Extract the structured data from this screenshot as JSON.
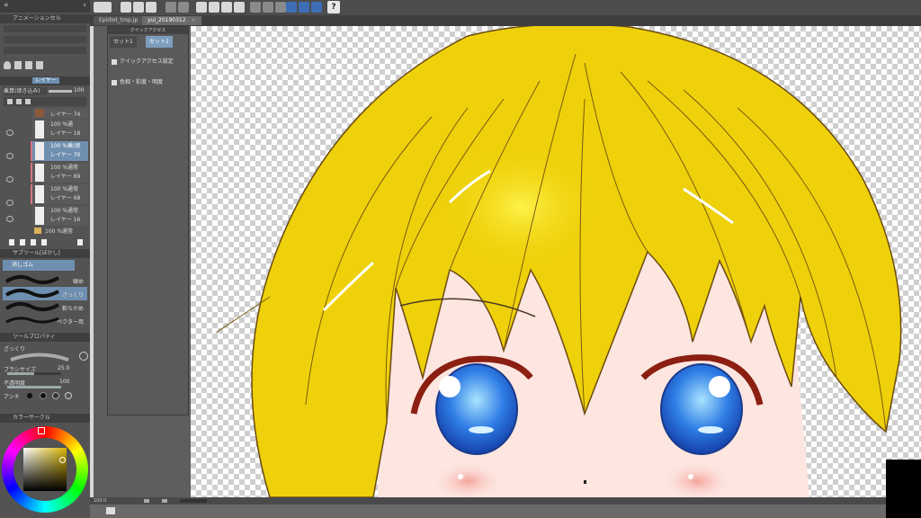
{
  "tabs": [
    {
      "label": "Epidiot_tmp.jp",
      "active": false
    },
    {
      "label": "yui_20190312",
      "active": true
    }
  ],
  "top_panel": {
    "title": "アニメーションセル"
  },
  "layer_panel": {
    "tab_label": "レイヤー",
    "blend": "乗算(焼き込み)",
    "opacity": "100",
    "layers": [
      {
        "name": "レイヤー 74",
        "mode": "",
        "selected": false
      },
      {
        "name": "レイヤー 18",
        "mode": "100 %通",
        "selected": false
      },
      {
        "name": "レイヤー 70",
        "mode": "100 %乗(焼",
        "selected": true
      },
      {
        "name": "レイヤー 69",
        "mode": "100 %通常",
        "selected": false
      },
      {
        "name": "レイヤー 68",
        "mode": "100 %通常",
        "selected": false
      },
      {
        "name": "レイヤー 16",
        "mode": "100 %通常",
        "selected": false
      },
      {
        "name": "",
        "mode": "100 %通常",
        "selected": false
      }
    ]
  },
  "subtool": {
    "title": "サブツール[ぼかし]",
    "group": "消しゴム",
    "items": [
      {
        "label": "硬め",
        "selected": false
      },
      {
        "label": "ざっくり",
        "selected": true
      },
      {
        "label": "軟らかめ",
        "selected": false
      },
      {
        "label": "ベクター用",
        "selected": false
      }
    ]
  },
  "tool_property": {
    "title": "ツールプロパティ",
    "name": "ざっくり",
    "brush_size_label": "ブラシサイズ",
    "brush_size": "25.0",
    "opacity_label": "不透明度",
    "opacity": "100",
    "aa_label": "アンチ"
  },
  "color_panel": {
    "title": "カラーサークル"
  },
  "quick_access": {
    "title": "クイックアクセス",
    "tabs": [
      {
        "label": "セット1",
        "active": false
      },
      {
        "label": "セット2",
        "active": true
      }
    ],
    "items": [
      "クイックアクセス設定",
      "色相・彩度・明度"
    ]
  },
  "status": {
    "zoom": "100.0"
  },
  "colors": {
    "hair": "#eed10a",
    "skin": "#fde5e0",
    "iris": "#2f7de6",
    "outline": "#6b4a10"
  }
}
